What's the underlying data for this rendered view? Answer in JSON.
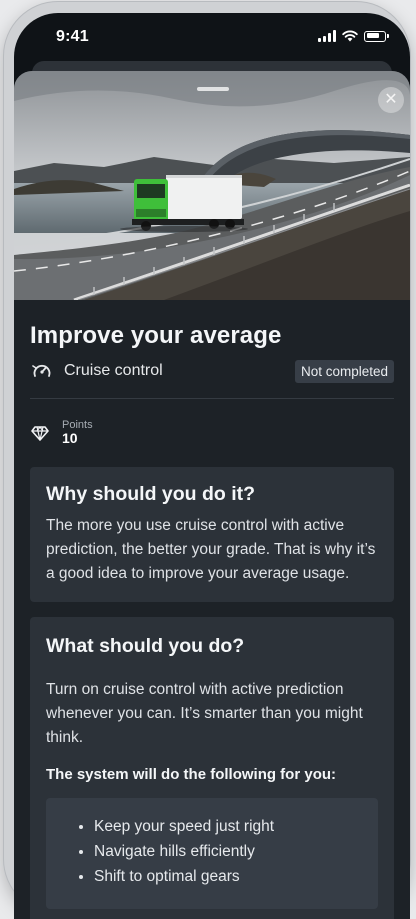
{
  "status_bar": {
    "time": "9:41"
  },
  "detail": {
    "title": "Improve your average",
    "category": "Cruise control",
    "status": "Not completed",
    "points_label": "Points",
    "points_value": "10"
  },
  "why": {
    "heading": "Why should you do it?",
    "body": "The more you use cruise control with active prediction, the better your grade. That is why it’s a good idea to improve your average usage."
  },
  "what": {
    "heading": "What should you do?",
    "body": "Turn on cruise control with active prediction whenever you can. It’s smarter than you might think.",
    "subheading": "The system will do the following for you:",
    "items": [
      "Keep your speed just right",
      "Navigate hills efficiently",
      "Shift to optimal gears"
    ]
  },
  "colors": {
    "sheet_bg": "#1d2227",
    "card_bg": "#2c3239",
    "truck_cab": "#3fbf3a"
  },
  "icons": {
    "close": "close-icon",
    "category": "gauge-icon",
    "points": "diamond-icon"
  }
}
